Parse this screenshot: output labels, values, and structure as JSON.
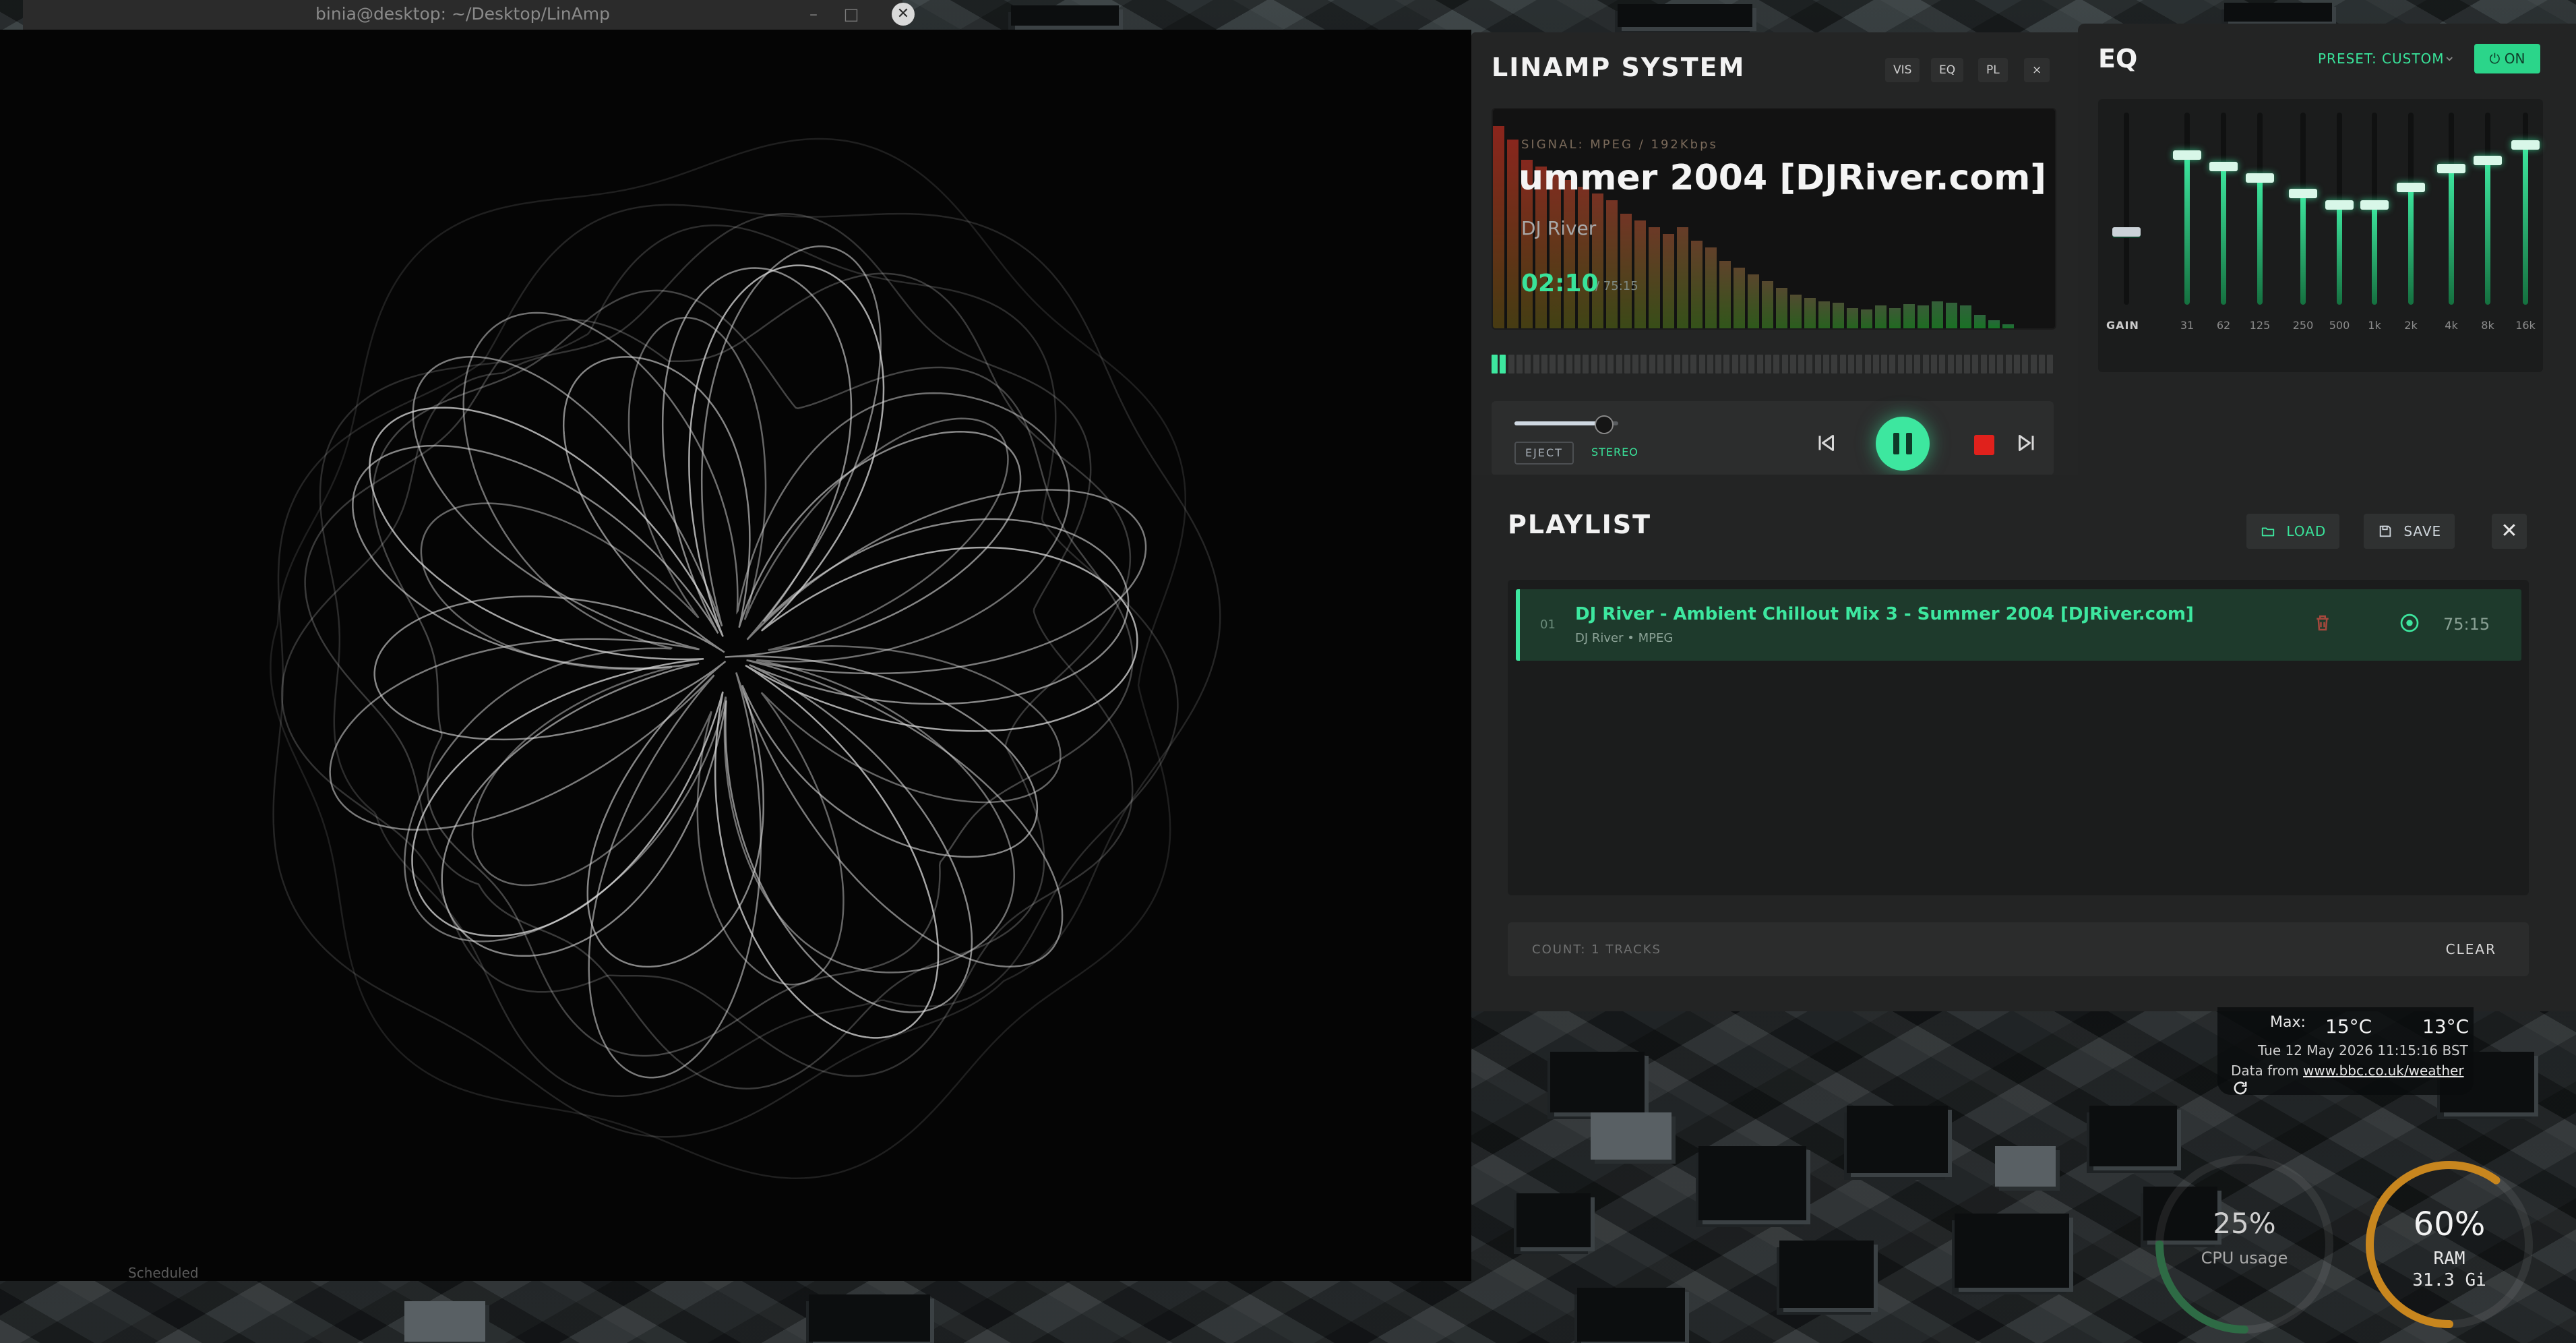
{
  "terminal": {
    "title": "binia@desktop: ~/Desktop/LinAmp",
    "minimize": "–",
    "maximize": "□",
    "close": "✕",
    "footer_label": "Scheduled"
  },
  "player": {
    "title": "LINAMP SYSTEM",
    "header_buttons": [
      "VIS",
      "EQ",
      "PL",
      "×"
    ],
    "signal": "SIGNAL: MPEG / 192Kbps",
    "track_title": "ummer 2004 [DJRiver.com]",
    "artist": "DJ River",
    "elapsed": "02:10",
    "total": "/ 75:15",
    "progress_fraction": 0.03,
    "volume_fraction": 0.85,
    "eject_label": "EJECT",
    "stereo_label": "STEREO",
    "accent": "#3de79f",
    "stop_color": "#e0211c"
  },
  "eq": {
    "title": "EQ",
    "preset": "PRESET: CUSTOM",
    "power_label": "ON",
    "gain_label": "GAIN",
    "gain_level": 0.38,
    "bands": [
      {
        "label": "31",
        "level": 0.78
      },
      {
        "label": "62",
        "level": 0.72
      },
      {
        "label": "125",
        "level": 0.66
      },
      {
        "label": "250",
        "level": 0.58
      },
      {
        "label": "500",
        "level": 0.52
      },
      {
        "label": "1k",
        "level": 0.52
      },
      {
        "label": "2k",
        "level": 0.61
      },
      {
        "label": "4k",
        "level": 0.71
      },
      {
        "label": "8k",
        "level": 0.75
      },
      {
        "label": "16k",
        "level": 0.83
      }
    ]
  },
  "playlist": {
    "title": "PLAYLIST",
    "load_label": "LOAD",
    "save_label": "SAVE",
    "close_label": "✕",
    "tracks": [
      {
        "number": "01",
        "title": "DJ River - Ambient Chillout Mix 3 - Summer 2004 [DJRiver.com]",
        "meta": "DJ River • MPEG",
        "duration": "75:15"
      }
    ],
    "count": "COUNT: 1 TRACKS",
    "clear_label": "CLEAR"
  },
  "weather": {
    "max_label": "Max:",
    "temp_today": "15°C",
    "temp_tomorrow": "13°C",
    "datetime": "Tue 12 May 2026 11:15:16 BST",
    "source_prefix": "Data from",
    "source_link": "www.bbc.co.uk/weather"
  },
  "system": {
    "cpu_value": "25%",
    "cpu_label": "CPU usage",
    "cpu_fraction": 0.25,
    "ram_value": "60%",
    "ram_label": "RAM",
    "ram_total": "31.3 Gi",
    "ram_fraction": 0.6,
    "cpu_color": "#2e6b45",
    "ram_color": "#c8861e"
  }
}
